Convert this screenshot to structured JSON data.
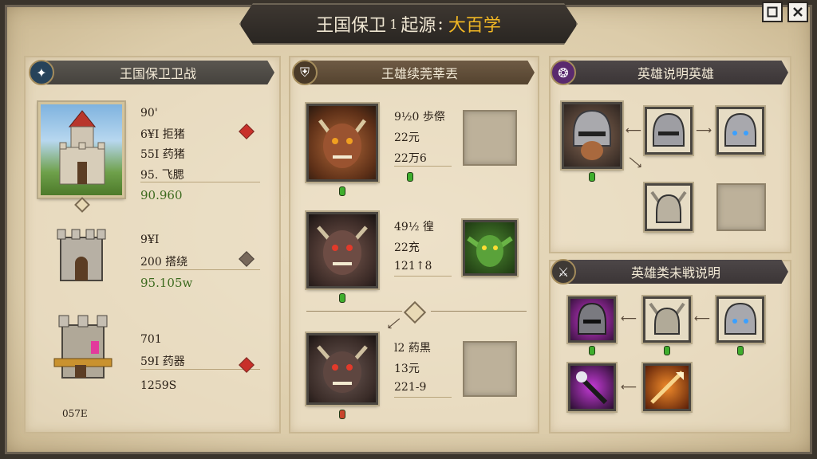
{
  "window": {
    "title_main": "王国保卫",
    "title_mid": "起源",
    "title_highlight": "大百学",
    "title_sep1": "1",
    "title_sep2": ":",
    "restore_icon": "restore-icon",
    "close_icon": "close-icon"
  },
  "left_panel": {
    "banner": "王国保卫卫战",
    "towers": [
      {
        "stats": [
          "90'",
          "6¥I 拒猪",
          "55I 药猪",
          "95. 飞腮"
        ],
        "highlight": "90.960",
        "gem": "red"
      },
      {
        "stats": [
          "9¥I",
          "200 搭绕"
        ],
        "highlight": "95.105w",
        "gem": "grey"
      },
      {
        "stats": [
          "701",
          "59I 药器"
        ],
        "highlight": "1259S",
        "gem": "red",
        "caption": "057E"
      }
    ]
  },
  "middle_panel": {
    "banner": "王雄续莞莘丟",
    "heroes": [
      {
        "stats": [
          "9½0 歩傺",
          "22元",
          "22万6"
        ],
        "pill": "green"
      },
      {
        "stats": [
          "49½ 徨",
          "22充",
          "121↑8"
        ],
        "pill": "green"
      },
      {
        "stats": [
          "l2 葯黒",
          "13元",
          "221-9"
        ],
        "pill": "red"
      }
    ]
  },
  "right_top_panel": {
    "banner": "英雄说明英雄"
  },
  "right_bottom_panel": {
    "banner": "英雄类未戦说明"
  },
  "colors": {
    "accent_gold": "#f2b824",
    "gem_red": "#c8302a",
    "pill_green": "#3fae2d",
    "parchment": "#e9dcc0"
  }
}
